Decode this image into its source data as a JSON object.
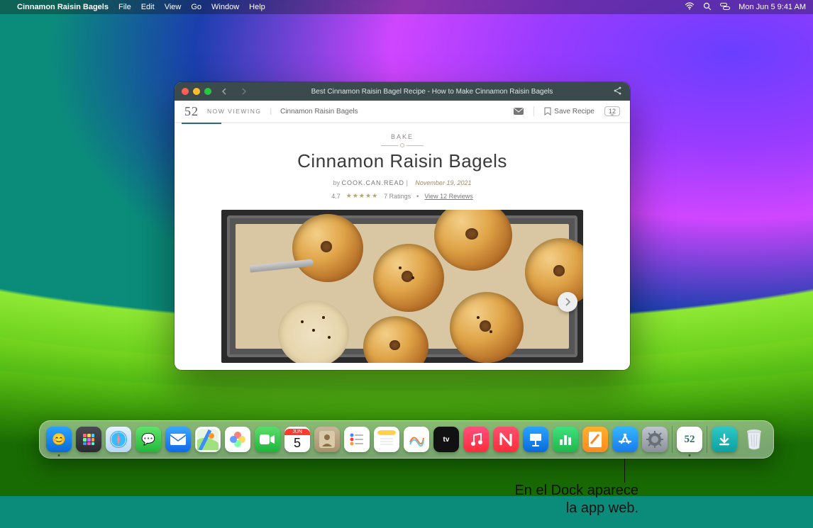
{
  "menubar": {
    "app_name": "Cinnamon Raisin Bagels",
    "items": [
      "File",
      "Edit",
      "View",
      "Go",
      "Window",
      "Help"
    ],
    "status_datetime": "Mon Jun 5  9:41 AM"
  },
  "window": {
    "title": "Best Cinnamon Raisin Bagel Recipe - How to Make Cinnamon Raisin Bagels",
    "site_logo": "52",
    "now_viewing_label": "NOW VIEWING",
    "breadcrumb": "Cinnamon Raisin Bagels",
    "save_label": "Save Recipe",
    "comment_count": "12",
    "category": "BAKE",
    "heading": "Cinnamon Raisin Bagels",
    "by_prefix": "by",
    "author": "COOK.CAN.READ",
    "date": "November 19, 2021",
    "rating_value": "4.7",
    "stars": "★★★★★",
    "ratings_label": "7 Ratings",
    "reviews_link": "View 12 Reviews"
  },
  "dock": {
    "apps": [
      {
        "name": "finder",
        "glyph": "🙂"
      },
      {
        "name": "launchpad",
        "glyph": "⊞"
      },
      {
        "name": "safari",
        "glyph": "🧭"
      },
      {
        "name": "messages",
        "glyph": "💬"
      },
      {
        "name": "mail",
        "glyph": "✉︎"
      },
      {
        "name": "maps",
        "glyph": "📍"
      },
      {
        "name": "photos",
        "glyph": "✿"
      },
      {
        "name": "facetime",
        "glyph": "📹"
      },
      {
        "name": "calendar",
        "top": "JUN",
        "day": "5"
      },
      {
        "name": "contacts",
        "glyph": "👤"
      },
      {
        "name": "reminders",
        "glyph": "☰"
      },
      {
        "name": "notes",
        "glyph": "📝"
      },
      {
        "name": "freeform",
        "glyph": "∿"
      },
      {
        "name": "tv",
        "glyph": "tv"
      },
      {
        "name": "music",
        "glyph": "♪"
      },
      {
        "name": "news",
        "glyph": "N"
      },
      {
        "name": "keynote",
        "glyph": "▭"
      },
      {
        "name": "numbers",
        "glyph": "▥"
      },
      {
        "name": "pages",
        "glyph": "✎"
      },
      {
        "name": "appstore",
        "glyph": "A"
      },
      {
        "name": "settings",
        "glyph": "⚙"
      }
    ],
    "web_app": {
      "name": "food52-webapp",
      "label": "52"
    },
    "downloads": {
      "name": "downloads",
      "glyph": "↓"
    },
    "trash": {
      "name": "trash",
      "glyph": "🗑"
    }
  },
  "callout": {
    "line1": "En el Dock aparece",
    "line2": "la app web."
  }
}
